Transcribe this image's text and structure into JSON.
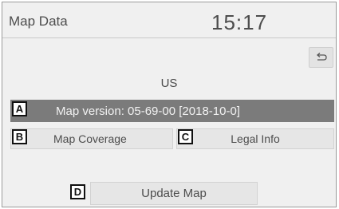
{
  "screen": {
    "title": "Map Data",
    "clock": "15:17"
  },
  "back_button": {
    "icon": "back-arrow-icon"
  },
  "region": "US",
  "map_version": "Map version: 05-69-00   [2018-10-0]",
  "buttons": {
    "map_coverage": "Map Coverage",
    "legal_info": "Legal Info",
    "update_map": "Update Map"
  },
  "callouts": {
    "a": "A",
    "b": "B",
    "c": "C",
    "d": "D"
  }
}
